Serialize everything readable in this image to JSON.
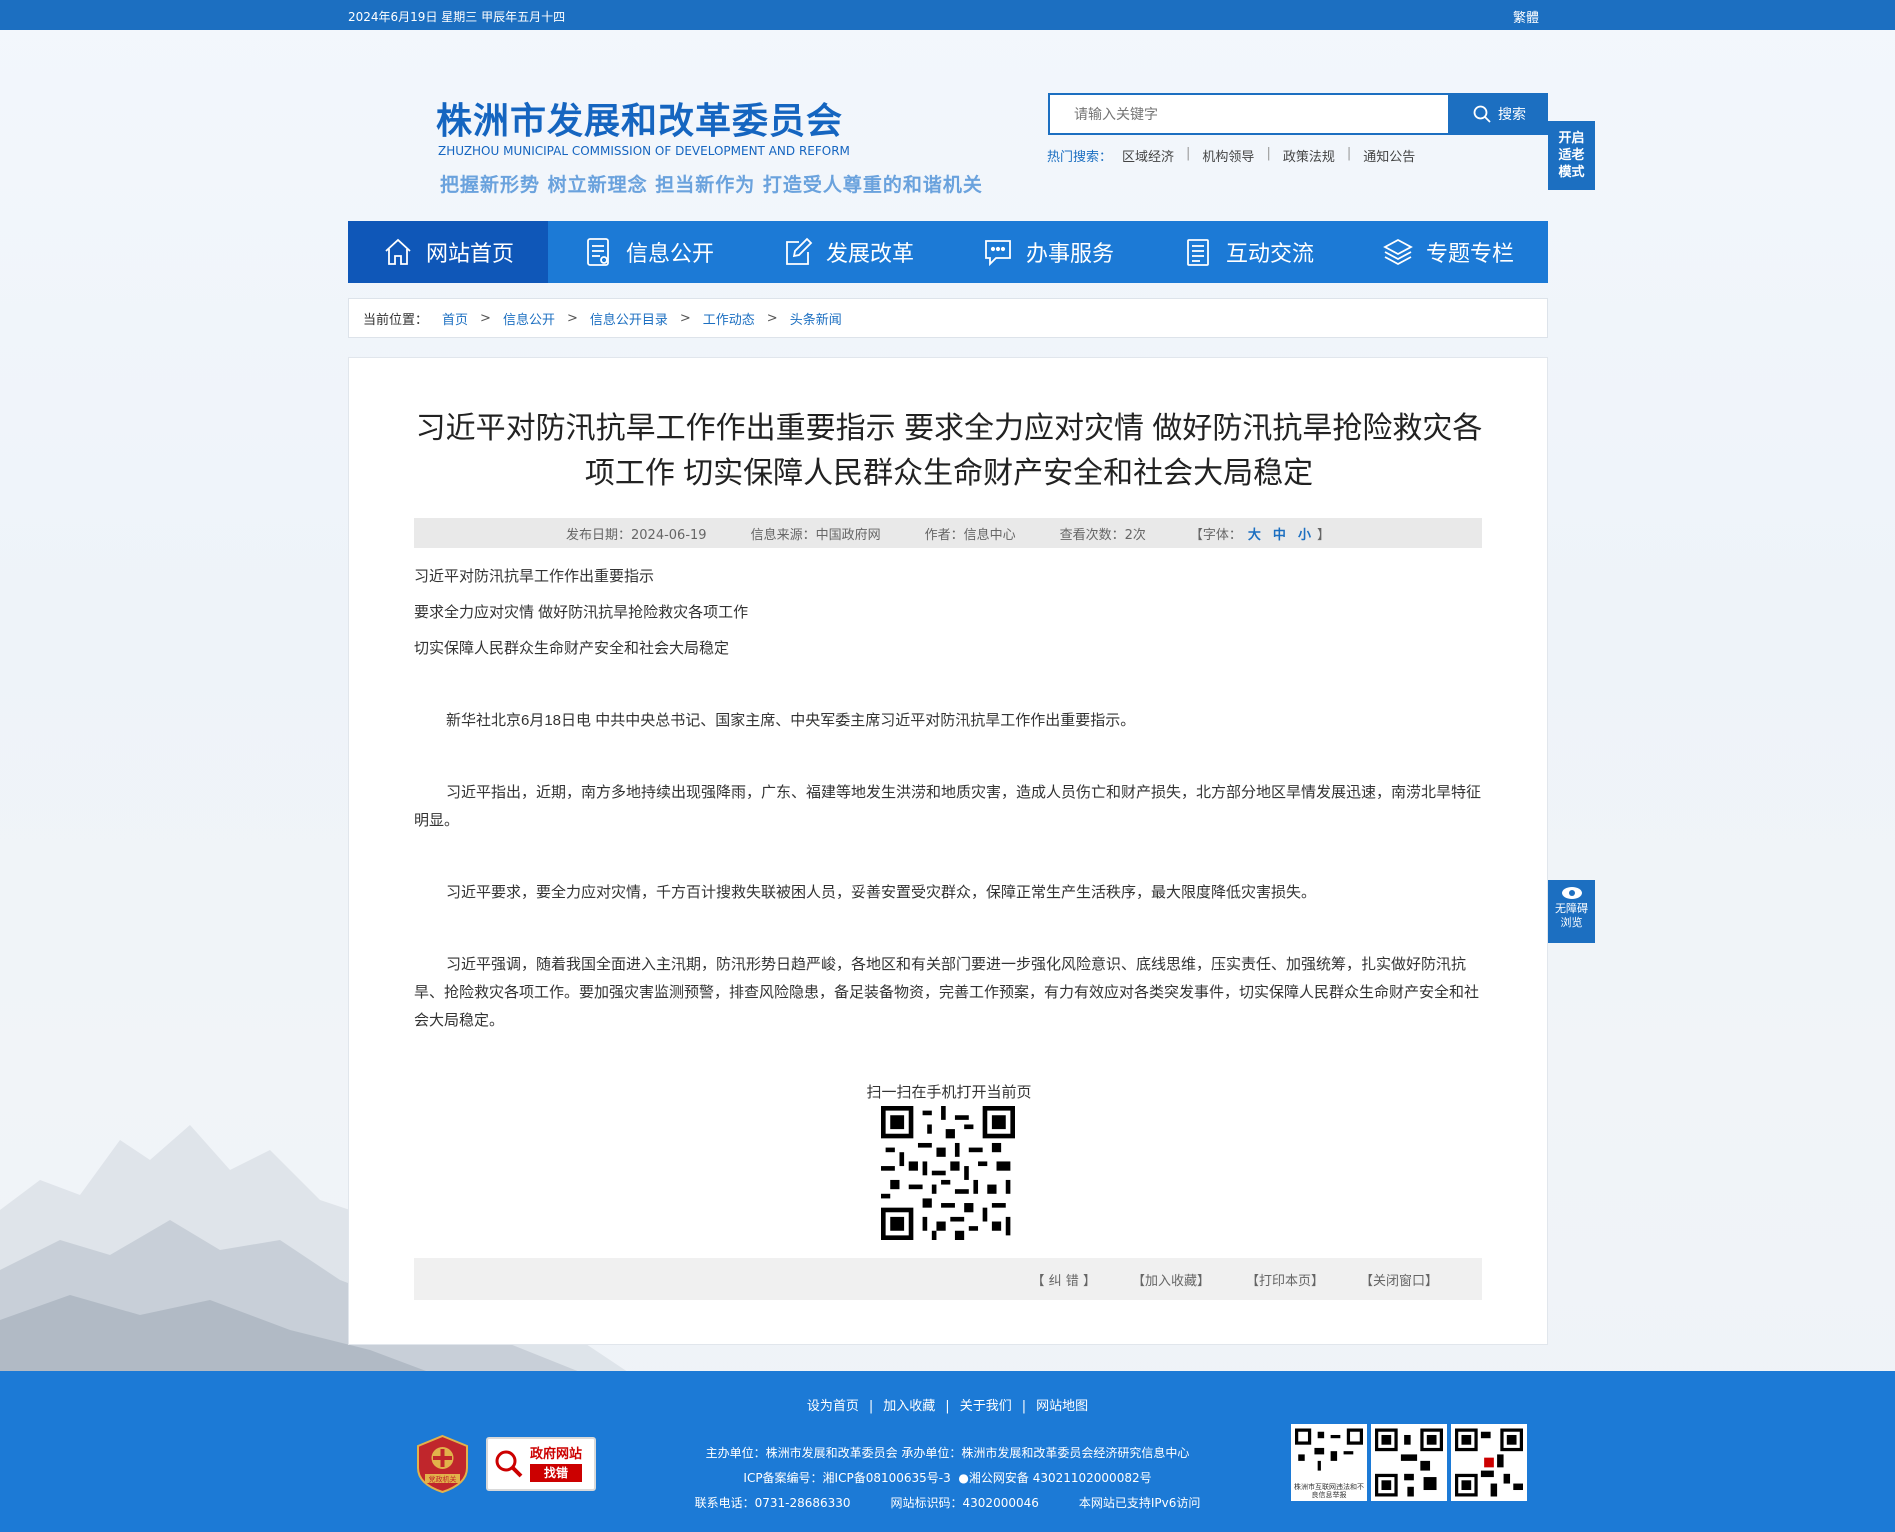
{
  "topbar": {
    "date": "2024年6月19日   星期三   甲辰年五月十四",
    "traditional": "繁體"
  },
  "header": {
    "title": "株洲市发展和改革委员会",
    "subtitle_en": "ZHUZHOU MUNICIPAL COMMISSION OF DEVELOPMENT AND REFORM",
    "slogan": "把握新形势 树立新理念 担当新作为 打造受人尊重的和谐机关",
    "search_placeholder": "请输入关键字",
    "search_button": "搜索",
    "hot_label": "热门搜索：",
    "hot_links": [
      "区域经济",
      "机构领导",
      "政策法规",
      "通知公告"
    ],
    "elder_mode": [
      "开启",
      "适老",
      "模式"
    ],
    "accessibility": [
      "无障碍",
      "浏览"
    ]
  },
  "nav": [
    {
      "label": "网站首页",
      "icon": "home-icon",
      "active": true
    },
    {
      "label": "信息公开",
      "icon": "document-list-icon",
      "active": false
    },
    {
      "label": "发展改革",
      "icon": "edit-icon",
      "active": false
    },
    {
      "label": "办事服务",
      "icon": "chat-icon",
      "active": false
    },
    {
      "label": "互动交流",
      "icon": "notes-icon",
      "active": false
    },
    {
      "label": "专题专栏",
      "icon": "layers-icon",
      "active": false
    }
  ],
  "breadcrumb": {
    "label": "当前位置：",
    "items": [
      "首页",
      "信息公开",
      "信息公开目录",
      "工作动态",
      "头条新闻"
    ]
  },
  "article": {
    "title_line1": "习近平对防汛抗旱工作作出重要指示 要求全力应对灾情 做好防汛抗旱抢险救灾各",
    "title_line2": "项工作 切实保障人民群众生命财产安全和社会大局稳定",
    "meta": {
      "date": "发布日期：2024-06-19",
      "source": "信息来源：中国政府网",
      "author": "作者：信息中心",
      "views": "查看次数：2次",
      "font_label": "【字体：",
      "font_large": "大",
      "font_medium": "中",
      "font_small": "小",
      "font_end": "】"
    },
    "lead": [
      "习近平对防汛抗旱工作作出重要指示",
      "要求全力应对灾情  做好防汛抗旱抢险救灾各项工作",
      "切实保障人民群众生命财产安全和社会大局稳定"
    ],
    "paragraphs": [
      "新华社北京6月18日电  中共中央总书记、国家主席、中央军委主席习近平对防汛抗旱工作作出重要指示。",
      "习近平指出，近期，南方多地持续出现强降雨，广东、福建等地发生洪涝和地质灾害，造成人员伤亡和财产损失，北方部分地区旱情发展迅速，南涝北旱特征明显。",
      "习近平要求，要全力应对灾情，千方百计搜救失联被困人员，妥善安置受灾群众，保障正常生产生活秩序，最大限度降低灾害损失。",
      "习近平强调，随着我国全面进入主汛期，防汛形势日趋严峻，各地区和有关部门要进一步强化风险意识、底线思维，压实责任、加强统筹，扎实做好防汛抗旱、抢险救灾各项工作。要加强灾害监测预警，排查风险隐患，备足装备物资，完善工作预案，有力有效应对各类突发事件，切实保障人民群众生命财产安全和社会大局稳定。"
    ],
    "qr_label": "扫一扫在手机打开当前页",
    "actions": [
      "【 纠 错 】",
      "【加入收藏】",
      "【打印本页】",
      "【关闭窗口】"
    ]
  },
  "footer": {
    "links": [
      "设为首页",
      "加入收藏",
      "关于我们",
      "网站地图"
    ],
    "sponsor": "主办单位：株洲市发展和改革委员会  承办单位：株洲市发展和改革委员会经济研究信息中心",
    "icp": "ICP备案编号：湘ICP备08100635号-3",
    "police": "湘公网安备 43021102000082号",
    "phone": "联系电话：0731-28686330",
    "site_code": "网站标识码：4302000046",
    "ipv6": "本网站已支持IPv6访问",
    "gov_site": "政府网站",
    "gov_error": "找错",
    "party_badge": "党政机关",
    "report_caption": "株洲市互联网违法和不良信息举报"
  },
  "colors": {
    "primary": "#1c7ad6",
    "primary_dark": "#0f57b8",
    "topbar": "#1c6fc1"
  }
}
